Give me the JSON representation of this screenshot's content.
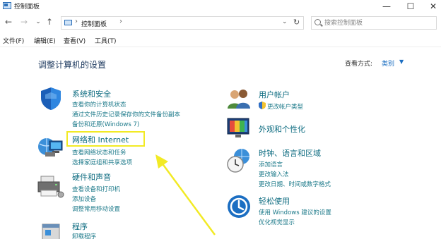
{
  "window": {
    "title": "控制面板",
    "min_glyph": "—",
    "max_glyph": "☐",
    "close_glyph": "✕"
  },
  "nav": {
    "back_glyph": "←",
    "forward_glyph": "→",
    "recent_glyph": "⌄",
    "up_glyph": "↑",
    "breadcrumb_sep": "›",
    "breadcrumb": "控制面板",
    "dropdown_glyph": "⌄",
    "refresh_glyph": "↻",
    "search_placeholder": "搜索控制面板"
  },
  "menu": [
    "文件(F)",
    "编辑(E)",
    "查看(V)",
    "工具(T)"
  ],
  "main": {
    "heading": "调整计算机的设置",
    "view_by_label": "查看方式:",
    "view_by_value": "类别",
    "view_by_arrow": "▼"
  },
  "categories": {
    "system": {
      "title": "系统和安全",
      "links": [
        "查看你的计算机状态",
        "通过文件历史记录保存你的文件备份副本",
        "备份和还原(Windows 7)"
      ]
    },
    "network": {
      "title": "网络和 Internet",
      "links": [
        "查看网络状态和任务",
        "选择家庭组和共享选项"
      ]
    },
    "hardware": {
      "title": "硬件和声音",
      "links": [
        "查看设备和打印机",
        "添加设备",
        "调整常用移动设置"
      ]
    },
    "programs": {
      "title": "程序",
      "links": [
        "卸载程序"
      ]
    },
    "accounts": {
      "title": "用户帐户",
      "links": [
        "更改帐户类型"
      ]
    },
    "appearance": {
      "title": "外观和个性化",
      "links": []
    },
    "clock": {
      "title": "时钟、语言和区域",
      "links": [
        "添加语言",
        "更改输入法",
        "更改日期、时间或数字格式"
      ]
    },
    "ease": {
      "title": "轻松使用",
      "links": [
        "使用 Windows 建议的设置",
        "优化视觉显示"
      ]
    }
  },
  "colors": {
    "link": "#1d7a8a",
    "category_title": "#0a6a7f",
    "highlight": "#f2ea25",
    "annotation_arrow": "#f2ea25"
  }
}
